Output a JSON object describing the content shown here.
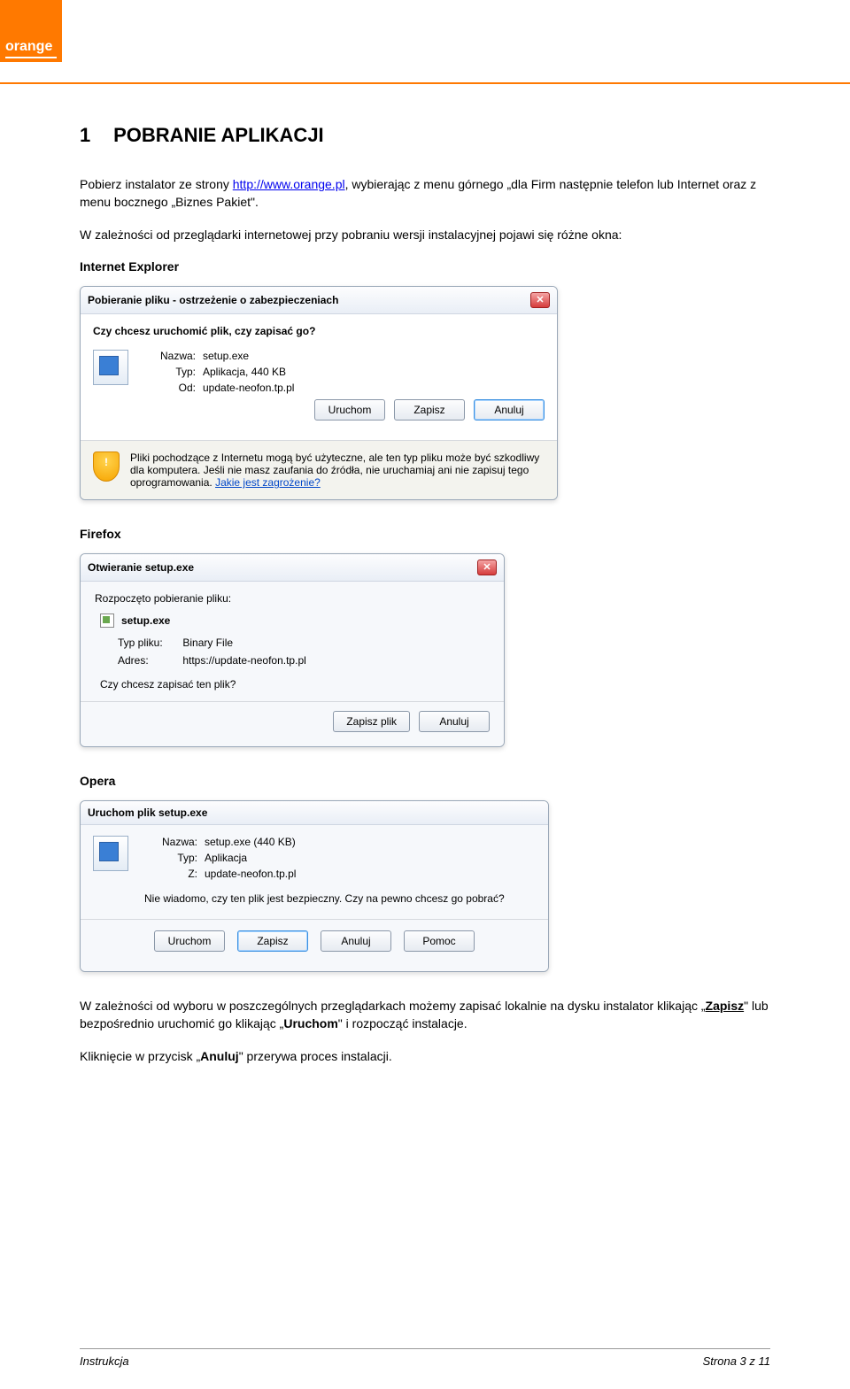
{
  "logo": {
    "text": "orange",
    "tm": "™"
  },
  "section": {
    "num": "1",
    "title": "POBRANIE APLIKACJI"
  },
  "intro": {
    "pre": "Pobierz instalator ze strony ",
    "url": "http://www.orange.pl",
    "post": ", wybierając z menu górnego „dla Firm następnie telefon lub Internet oraz z menu bocznego „Biznes Pakiet\"."
  },
  "depends": "W zależności od przeglądarki internetowej przy pobraniu wersji instalacyjnej pojawi się różne okna:",
  "labels": {
    "ie": "Internet Explorer",
    "ff": "Firefox",
    "op": "Opera"
  },
  "ie": {
    "title": "Pobieranie pliku - ostrzeżenie o zabezpieczeniach",
    "question": "Czy chcesz uruchomić plik, czy zapisać go?",
    "name_k": "Nazwa:",
    "name_v": "setup.exe",
    "type_k": "Typ:",
    "type_v": "Aplikacja, 440 KB",
    "from_k": "Od:",
    "from_v": "update-neofon.tp.pl",
    "run": "Uruchom",
    "save": "Zapisz",
    "cancel": "Anuluj",
    "warn": "Pliki pochodzące z Internetu mogą być użyteczne, ale ten typ pliku może być szkodliwy dla komputera. Jeśli nie masz zaufania do źródła, nie uruchamiaj ani nie zapisuj tego oprogramowania. ",
    "warn_link": "Jakie jest zagrożenie?"
  },
  "ff": {
    "title": "Otwieranie setup.exe",
    "lead": "Rozpoczęto pobieranie pliku:",
    "file": "setup.exe",
    "type_k": "Typ pliku:",
    "type_v": "Binary File",
    "addr_k": "Adres:",
    "addr_v": "https://update-neofon.tp.pl",
    "ask": "Czy chcesz zapisać ten plik?",
    "save": "Zapisz plik",
    "cancel": "Anuluj"
  },
  "op": {
    "title": "Uruchom plik setup.exe",
    "name_k": "Nazwa:",
    "name_v": "setup.exe (440 KB)",
    "type_k": "Typ:",
    "type_v": "Aplikacja",
    "from_k": "Z:",
    "from_v": "update-neofon.tp.pl",
    "ask": "Nie wiadomo, czy ten plik jest bezpieczny. Czy na pewno chcesz go pobrać?",
    "run": "Uruchom",
    "save": "Zapisz",
    "cancel": "Anuluj",
    "help": "Pomoc"
  },
  "outro1_a": "W zależności od wyboru w poszczególnych przeglądarkach możemy zapisać lokalnie na dysku instalator klikając „",
  "outro1_bold1": "Zapisz",
  "outro1_b": "\" lub bezpośrednio uruchomić go klikając „",
  "outro1_bold2": "Uruchom",
  "outro1_c": "\" i rozpocząć instalacje.",
  "outro2_a": "Kliknięcie w przycisk „",
  "outro2_bold": "Anuluj",
  "outro2_b": "\" przerywa proces instalacji.",
  "footer": {
    "left": "Instrukcja",
    "right": "Strona 3 z 11"
  }
}
